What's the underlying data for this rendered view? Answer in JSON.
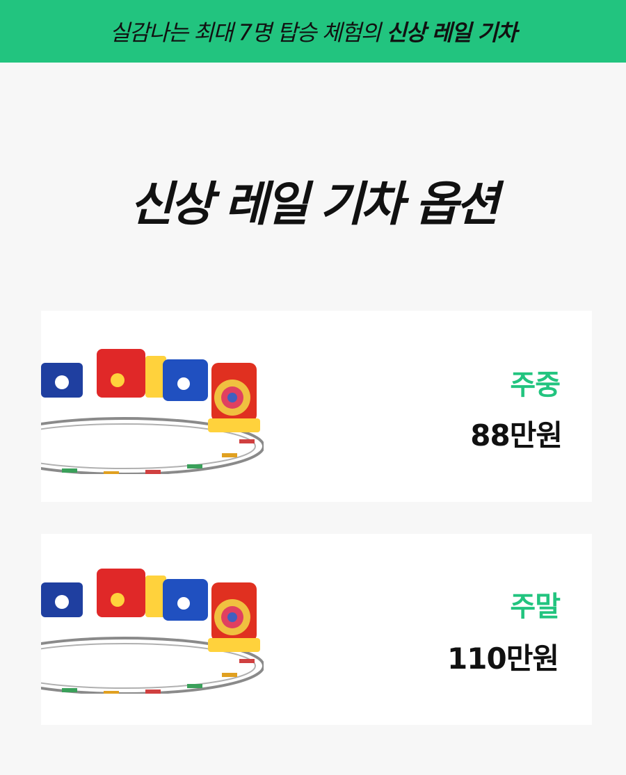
{
  "banner": {
    "text_regular": "실감나는 최대 7명 탑승 체험의 ",
    "text_bold": "신상 레일 기차"
  },
  "title": "신상 레일 기차 옵션",
  "options": [
    {
      "label": "주중",
      "price": "88만원"
    },
    {
      "label": "주말",
      "price": "110만원"
    }
  ],
  "colors": {
    "accent": "#22c47f",
    "background": "#f7f7f7",
    "card": "#ffffff",
    "text": "#111111"
  },
  "icons": [
    "train-illustration-icon"
  ]
}
